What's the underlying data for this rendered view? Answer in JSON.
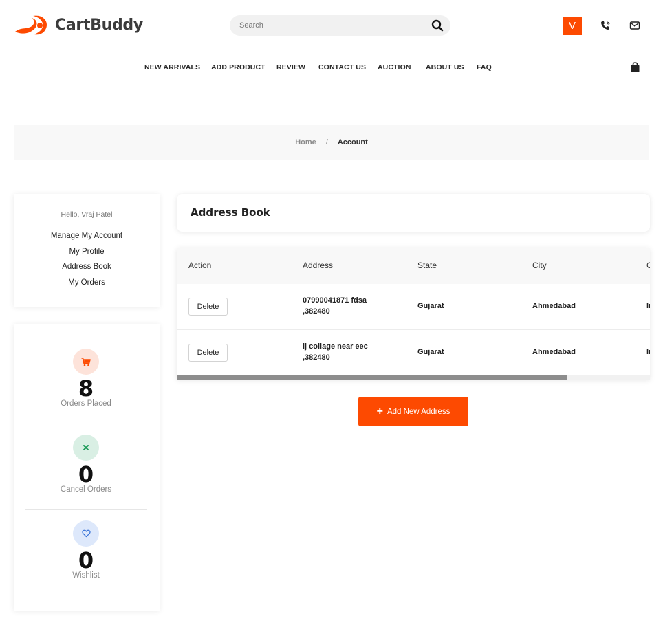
{
  "brand": {
    "name": "CartBuddy",
    "accent": "#fd4a01"
  },
  "header": {
    "search_placeholder": "Search",
    "avatar_initial": "V"
  },
  "nav": {
    "items": [
      "NEW ARRIVALS",
      "ADD PRODUCT",
      "REVIEW",
      "CONTACT US",
      "AUCTION",
      "ABOUT US",
      "FAQ"
    ]
  },
  "breadcrumb": {
    "home": "Home",
    "separator": "/",
    "current": "Account"
  },
  "account_menu": {
    "greeting": "Hello, Vraj Patel",
    "links": [
      "Manage My Account",
      "My Profile",
      "Address Book",
      "My Orders"
    ]
  },
  "stats": [
    {
      "value": "8",
      "label": "Orders Placed",
      "icon": "cart-icon",
      "bg": "#fde3da",
      "color": "#fd4a01"
    },
    {
      "value": "0",
      "label": "Cancel Orders",
      "icon": "close-icon",
      "bg": "#d9efe4",
      "color": "#1e9b5a"
    },
    {
      "value": "0",
      "label": "Wishlist",
      "icon": "heart-icon",
      "bg": "#dde8fb",
      "color": "#3a74d8"
    }
  ],
  "address_book": {
    "title": "Address Book",
    "columns": [
      "Action",
      "Address",
      "State",
      "City",
      "C"
    ],
    "rows": [
      {
        "action": "Delete",
        "address_line1": "07990041871 fdsa",
        "address_line2": ",382480",
        "state": "Gujarat",
        "city": "Ahmedabad",
        "country_partial": "In"
      },
      {
        "action": "Delete",
        "address_line1": "lj collage near eec",
        "address_line2": ",382480",
        "state": "Gujarat",
        "city": "Ahmedabad",
        "country_partial": "In"
      }
    ],
    "add_button": "Add New Address"
  }
}
